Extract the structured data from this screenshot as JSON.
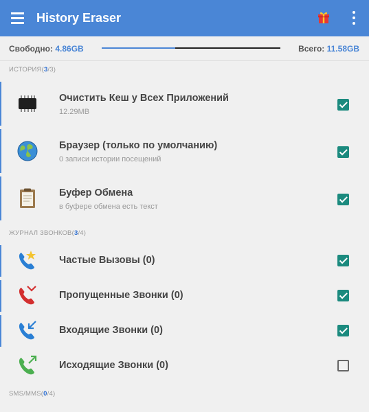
{
  "appbar": {
    "title": "History Eraser",
    "menu_icon": "menu-icon",
    "gift_icon": "gift-icon",
    "more_icon": "more-vert-icon"
  },
  "storage": {
    "free_label": "Свободно:",
    "free_value": "4.86GB",
    "total_label": "Всего:",
    "total_value": "11.58GB",
    "used_fraction": 0.41
  },
  "sections": {
    "history": {
      "label": "ИСТОРИЯ(",
      "selected": "3",
      "total": "/3)"
    },
    "calls": {
      "label": "ЖУРНАЛ ЗВОНКОВ(",
      "selected": "3",
      "total": "/4)"
    },
    "sms": {
      "label": "SMS/MMS(",
      "selected": "0",
      "total": "/4)"
    }
  },
  "history_items": [
    {
      "title": "Очистить Кеш у Всех Приложений",
      "subtitle": "12.29MB",
      "icon": "chip-icon",
      "checked": true
    },
    {
      "title": "Браузер (только по умолчанию)",
      "subtitle": "0 записи истории посещений",
      "icon": "globe-icon",
      "checked": true
    },
    {
      "title": "Буфер Обмена",
      "subtitle": "в буфере обмена есть текст",
      "icon": "clipboard-icon",
      "checked": true
    }
  ],
  "call_items": [
    {
      "title": "Частые Вызовы (0)",
      "icon": "frequent-call-icon",
      "checked": true
    },
    {
      "title": "Пропущенные Звонки (0)",
      "icon": "missed-call-icon",
      "checked": true
    },
    {
      "title": "Входящие Звонки (0)",
      "icon": "incoming-call-icon",
      "checked": true
    },
    {
      "title": "Исходящие Звонки (0)",
      "icon": "outgoing-call-icon",
      "checked": false
    }
  ],
  "colors": {
    "accent": "#4a86d6",
    "check": "#1b8a7e"
  }
}
